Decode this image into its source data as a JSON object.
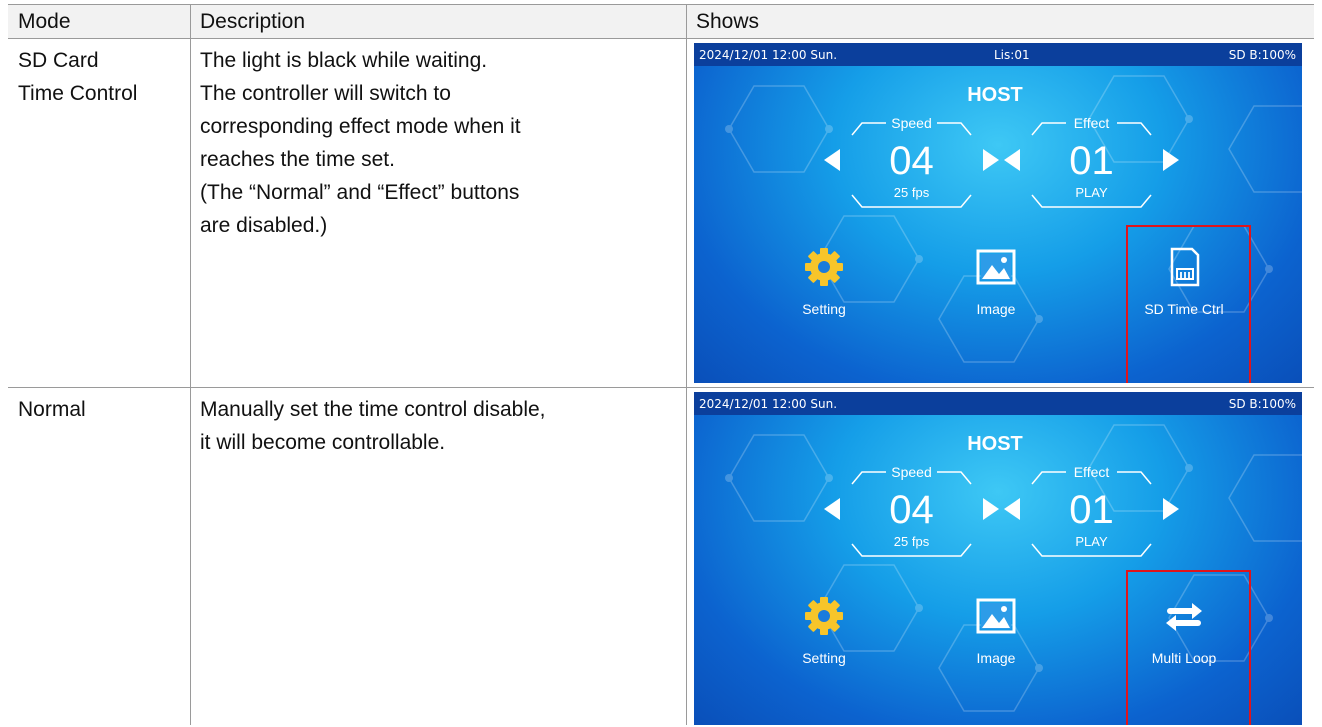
{
  "table": {
    "headers": [
      "Mode",
      "Description",
      "Shows"
    ],
    "rows": [
      {
        "mode_lines": [
          "SD Card",
          "Time Control"
        ],
        "description_lines": [
          "The light is black while waiting.",
          "The controller will switch to",
          "corresponding effect mode when it",
          "reaches the time set.",
          "(The “Normal” and “Effect” buttons",
          "are disabled.)"
        ],
        "screen": {
          "status_left": "2024/12/01 12:00 Sun.",
          "status_center": "Lis:01",
          "status_right": "SD B:100%",
          "host": "HOST",
          "speed_label": "Speed",
          "speed_value": "04",
          "speed_sub": "25 fps",
          "effect_label": "Effect",
          "effect_value": "01",
          "effect_sub": "PLAY",
          "tool1": "Setting",
          "tool2": "Image",
          "tool3": "SD Time Ctrl",
          "tool3_icon": "sd-card-icon",
          "highlight_color": "#e0141b"
        }
      },
      {
        "mode_lines": [
          "Normal"
        ],
        "description_lines": [
          "Manually set the time control disable,",
          "it will become controllable."
        ],
        "screen": {
          "status_left": "2024/12/01 12:00 Sun.",
          "status_center": "",
          "status_right": "SD B:100%",
          "host": "HOST",
          "speed_label": "Speed",
          "speed_value": "04",
          "speed_sub": "25 fps",
          "effect_label": "Effect",
          "effect_value": "01",
          "effect_sub": "PLAY",
          "tool1": "Setting",
          "tool2": "Image",
          "tool3": "Multi Loop",
          "tool3_icon": "loop-icon",
          "highlight_color": "#e0141b"
        }
      }
    ]
  }
}
